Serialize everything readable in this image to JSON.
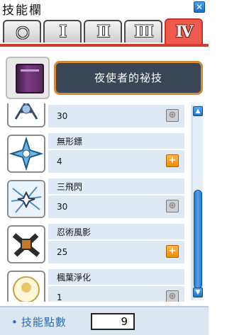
{
  "window": {
    "title": "技能欄",
    "close_icon": "close-icon"
  },
  "tabs": [
    {
      "label": "○",
      "active": false
    },
    {
      "label": "Ⅰ",
      "active": false
    },
    {
      "label": "Ⅱ",
      "active": false
    },
    {
      "label": "Ⅲ",
      "active": false
    },
    {
      "label": "Ⅳ",
      "active": true
    }
  ],
  "banner": {
    "book_icon": "skill-book-icon",
    "title": "夜使者的祕技"
  },
  "skills": [
    {
      "name": "",
      "level": "30",
      "plus_enabled": false,
      "icon": "partial-skill-icon"
    },
    {
      "name": "無形鏢",
      "level": "4",
      "plus_enabled": true,
      "icon": "shuriken-skill-icon"
    },
    {
      "name": "三飛閃",
      "level": "30",
      "plus_enabled": false,
      "icon": "triple-throw-skill-icon"
    },
    {
      "name": "忍術風影",
      "level": "25",
      "plus_enabled": true,
      "icon": "ninja-ambush-skill-icon"
    },
    {
      "name": "楓葉淨化",
      "level": "1",
      "plus_enabled": false,
      "icon": "maple-purify-skill-icon"
    }
  ],
  "footer": {
    "label": "技能點數",
    "points": "9"
  },
  "colors": {
    "active_tab": "#ef5a4f",
    "banner_bg": "#3a4656",
    "banner_border": "#d58a3a",
    "plus_enabled": "#f08c00"
  }
}
